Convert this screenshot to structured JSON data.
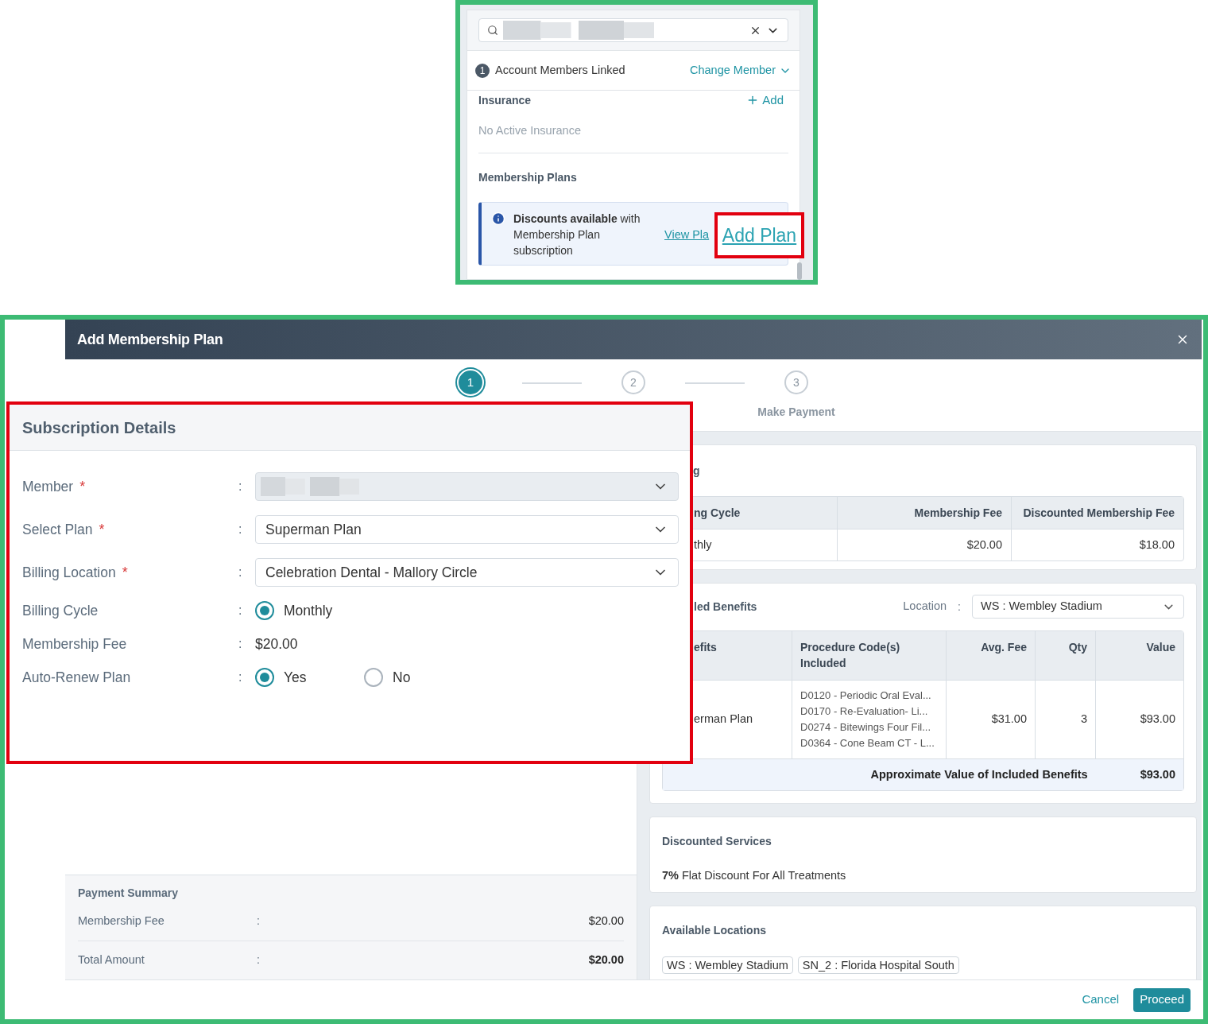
{
  "member_panel": {
    "linked": {
      "count": "1",
      "label": "Account Members Linked",
      "action": "Change Member"
    },
    "insurance": {
      "title": "Insurance",
      "action": "Add",
      "empty": "No Active Insurance"
    },
    "membership": {
      "title": "Membership Plans",
      "notice": "**Discounts available** with Membership Plan subscription",
      "view_link": "View Pla",
      "add_link": "Add Plan"
    }
  },
  "modal": {
    "title": "Add Membership Plan",
    "steps": [
      {
        "number": "1",
        "selected": true
      },
      {
        "number": "2",
        "selected": false
      },
      {
        "number": "3",
        "label": "Make Payment",
        "selected": false
      }
    ],
    "subscription": {
      "title": "Subscription Details",
      "fields": [
        {
          "kind": "select",
          "label": "Member",
          "required_mark": "*",
          "separator": ":",
          "disabled": true
        },
        {
          "kind": "select",
          "label": "Select Plan",
          "required_mark": "*",
          "separator": ":",
          "disabled": false,
          "value": "Superman Plan"
        },
        {
          "kind": "select",
          "label": "Billing Location",
          "required_mark": "*",
          "separator": ":",
          "disabled": false,
          "value": "Celebration Dental - Mallory Circle"
        },
        {
          "kind": "radio",
          "label": "Billing Cycle",
          "separator": ":",
          "options": [
            {
              "label": "Monthly",
              "selected": true
            }
          ]
        },
        {
          "kind": "text",
          "label": "Membership Fee",
          "separator": ":",
          "value": "$20.00"
        },
        {
          "kind": "radio",
          "label": "Auto-Renew Plan",
          "separator": ":",
          "options": [
            {
              "label": "Yes",
              "selected": true
            },
            {
              "label": "No",
              "selected": false
            }
          ]
        }
      ]
    },
    "payment_summary": {
      "title": "Payment Summary",
      "rows": [
        {
          "label": "Membership Fee",
          "separator": ":",
          "value": "$20.00",
          "bold": false
        },
        {
          "label": "Total Amount",
          "separator": ":",
          "value": "$20.00",
          "bold": true
        }
      ]
    },
    "billing": {
      "title": "g",
      "columns": [
        "ng Cycle",
        "Membership Fee",
        "Discounted Membership Fee"
      ],
      "rows": [
        [
          "thly",
          "$20.00",
          "$18.00"
        ]
      ]
    },
    "benefits": {
      "title": "led Benefits",
      "location_label": "Location",
      "location_separator": ":",
      "location": "WS : Wembley Stadium",
      "columns": [
        "efits",
        "Procedure Code(s) Included",
        "Avg. Fee",
        "Qty",
        "Value"
      ],
      "rows": [
        {
          "plan": "erman Plan",
          "codes": [
            "D0120 - Periodic Oral Eval...",
            "D0170 - Re-Evaluation- Li...",
            "D0274 - Bitewings Four Fil...",
            "D0364 - Cone Beam CT - L..."
          ],
          "avg_fee": "$31.00",
          "qty": "3",
          "value": "$93.00"
        }
      ],
      "total_label": "Approximate Value of Included Benefits",
      "total": "$93.00"
    },
    "discounted_services": {
      "title": "Discounted Services",
      "text": "**7%** Flat Discount For All Treatments"
    },
    "available_locations": {
      "title": "Available Locations",
      "locations": [
        "WS : Wembley Stadium",
        "SN_2 : Florida Hospital South"
      ]
    },
    "footer": {
      "cancel": "Cancel",
      "proceed": "Proceed"
    }
  }
}
